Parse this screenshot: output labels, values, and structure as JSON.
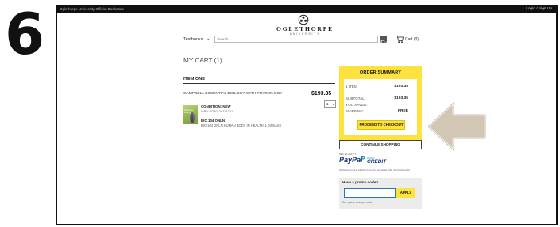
{
  "step": {
    "number": "6"
  },
  "topbar": {
    "left_text": "Oglethorpe University Official Bookstore",
    "right_text": "Login / Sign Up"
  },
  "brand": {
    "name": "OGLETHORPE",
    "sub": "UNIVERSITY"
  },
  "nav": {
    "category_label": "Textbooks",
    "search_placeholder": "Search",
    "cart_label": "Cart (0)"
  },
  "cart": {
    "heading": "MY CART (1)",
    "item_heading": "ITEM ONE",
    "item": {
      "title": "CAMPBELL ESSENTIAL BIOLOGY WITH PHYSIOLOGY",
      "price": "$193.35",
      "quantity": "1",
      "condition": "CONDITION: NEW",
      "isbn": "ISBN: 9780134711751",
      "course_code": "BIO 104 ONLN",
      "course_name": "BIO 104 ONLN HUMAN BODY IN HEALTH & DISEASE",
      "cover_text": "Essential Biology"
    }
  },
  "summary": {
    "title": "ORDER SUMMARY",
    "items_label": "1 ITEM",
    "items_value": "$193.35",
    "subtotal_label": "SUBTOTAL:",
    "subtotal_value": "$193.35",
    "saved_label": "YOU SAVED:",
    "saved_value": "",
    "shipping_label": "SHIPPING:",
    "shipping_value": "FREE",
    "checkout_label": "PROCEED TO CHECKOUT"
  },
  "continue_label": "CONTINUE SHOPPING",
  "payment": {
    "accept_label": "WE ACCEPT",
    "paypal_label": "PayPal",
    "credit_top": "PayPal",
    "credit_label": "CREDIT",
    "note": "No Interest if paid in full within 6 months. See details. Offer with PayPal credit."
  },
  "promo": {
    "title": "Have a promo code?",
    "input_value": "",
    "apply_label": "APPLY",
    "note": "One promo code per order."
  },
  "colors": {
    "accent_yellow": "#ffe23d",
    "callout_arrow": "#d2c6b5",
    "topbar": "#111111"
  }
}
